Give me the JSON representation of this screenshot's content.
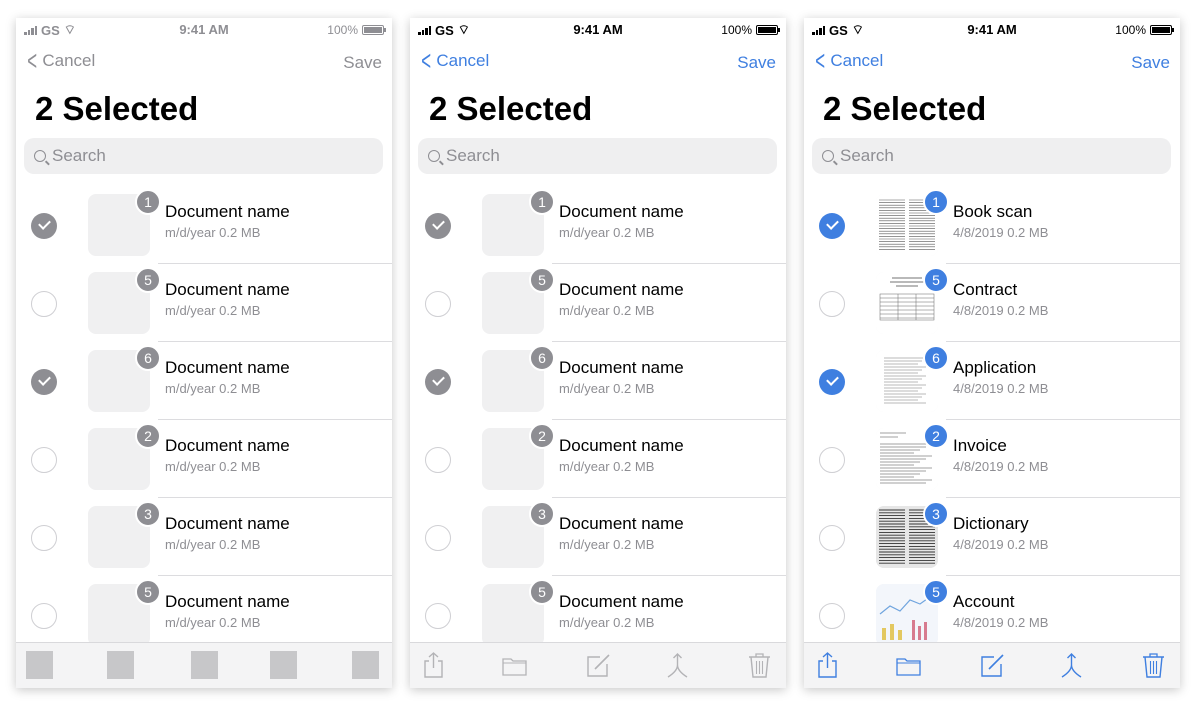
{
  "status_bar": {
    "carrier": "GS",
    "time": "9:41 AM",
    "battery": "100%"
  },
  "nav": {
    "cancel_label": "Cancel",
    "save_label": "Save",
    "title": "2 Selected"
  },
  "search": {
    "placeholder": "Search"
  },
  "colors": {
    "accent": "#3f7fe0",
    "placeholder_grey": "#8e8e93"
  },
  "placeholder_rows": [
    {
      "badge": "1",
      "name": "Document name",
      "meta": "m/d/year 0.2 MB",
      "selected": true
    },
    {
      "badge": "5",
      "name": "Document name",
      "meta": "m/d/year 0.2 MB",
      "selected": false
    },
    {
      "badge": "6",
      "name": "Document name",
      "meta": "m/d/year 0.2 MB",
      "selected": true
    },
    {
      "badge": "2",
      "name": "Document name",
      "meta": "m/d/year 0.2 MB",
      "selected": false
    },
    {
      "badge": "3",
      "name": "Document name",
      "meta": "m/d/year 0.2 MB",
      "selected": false
    },
    {
      "badge": "5",
      "name": "Document name",
      "meta": "m/d/year 0.2 MB",
      "selected": false
    }
  ],
  "document_rows": [
    {
      "badge": "1",
      "name": "Book scan",
      "meta": "4/8/2019 0.2 MB",
      "selected": true,
      "thumb": "book-scan"
    },
    {
      "badge": "5",
      "name": "Contract",
      "meta": "4/8/2019 0.2 MB",
      "selected": false,
      "thumb": "contract"
    },
    {
      "badge": "6",
      "name": "Application",
      "meta": "4/8/2019 0.2 MB",
      "selected": true,
      "thumb": "application"
    },
    {
      "badge": "2",
      "name": "Invoice",
      "meta": "4/8/2019 0.2 MB",
      "selected": false,
      "thumb": "invoice"
    },
    {
      "badge": "3",
      "name": "Dictionary",
      "meta": "4/8/2019 0.2 MB",
      "selected": false,
      "thumb": "dictionary"
    },
    {
      "badge": "5",
      "name": "Account",
      "meta": "4/8/2019 0.2 MB",
      "selected": false,
      "thumb": "account"
    }
  ],
  "toolbar_icons": [
    "share-icon",
    "folder-icon",
    "edit-icon",
    "merge-icon",
    "trash-icon"
  ]
}
